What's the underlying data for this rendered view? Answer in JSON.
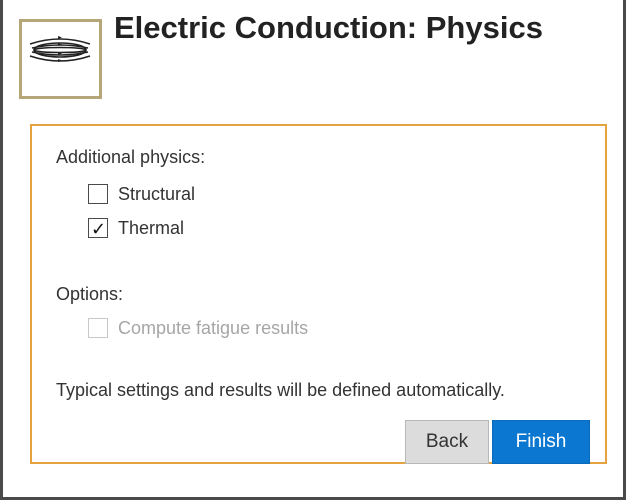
{
  "header": {
    "title": "Electric Conduction: Physics",
    "icon": "electric-field-lines-icon",
    "accent_color": "#b7a57a"
  },
  "panel": {
    "border_color": "#e5a33f",
    "additional_physics_label": "Additional physics:",
    "physics_options": [
      {
        "label": "Structural",
        "checked": false,
        "enabled": true
      },
      {
        "label": "Thermal",
        "checked": true,
        "enabled": true
      }
    ],
    "options_label": "Options:",
    "options": [
      {
        "label": "Compute fatigue results",
        "checked": false,
        "enabled": false
      }
    ],
    "info_text": "Typical settings and results will be defined automatically."
  },
  "buttons": {
    "back_label": "Back",
    "finish_label": "Finish",
    "finish_color": "#0b77d1"
  }
}
